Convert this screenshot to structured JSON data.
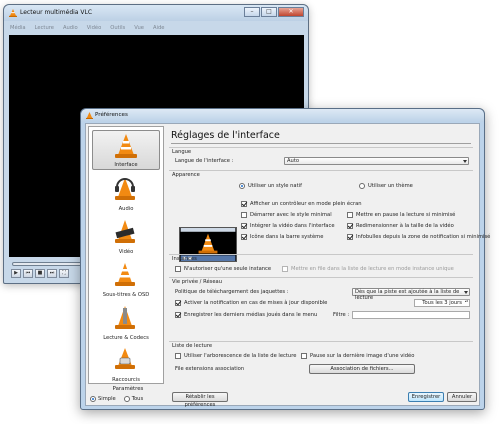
{
  "vlc_window": {
    "title": "Lecteur multimédia VLC",
    "menu": [
      "Média",
      "Lecture",
      "Audio",
      "Vidéo",
      "Outils",
      "Vue",
      "Aide"
    ]
  },
  "preferences": {
    "window_title": "Préférences",
    "sidebar": {
      "items": [
        {
          "label": "Interface",
          "icon": "vlc-cone-icon"
        },
        {
          "label": "Audio",
          "icon": "headphones-cone-icon"
        },
        {
          "label": "Vidéo",
          "icon": "film-cone-icon"
        },
        {
          "label": "Sous-titres & OSD",
          "icon": "subtitles-cone-icon"
        },
        {
          "label": "Lecture & Codecs",
          "icon": "codec-cone-icon"
        },
        {
          "label": "Raccourcis",
          "icon": "hotkeys-cone-icon"
        }
      ],
      "params_label": "Paramètres",
      "simple_label": "Simple",
      "all_label": "Tous"
    },
    "heading": "Réglages de l'interface",
    "langue": {
      "section": "Langue",
      "label": "Langue de l'interface :",
      "value": "Auto"
    },
    "apparence": {
      "section": "Apparence",
      "native_label": "Utiliser un style natif",
      "theme_label": "Utiliser un thème",
      "fullscreen_ctrl": "Afficher un contrôleur en mode plein écran",
      "minimal": "Démarrer avec le style minimal",
      "pause_minimized": "Mettre en pause la lecture si minimisé",
      "embed_video": "Intégrer la vidéo dans l'interface",
      "resize_video": "Redimensionner à la taille de la vidéo",
      "systray": "Icône dans la barre système",
      "popup": "Infobulles depuis la zone de notification si minimisé"
    },
    "instances": {
      "section": "Instances",
      "single": "N'autoriser qu'une seule instance",
      "enqueue": "Mettre en file dans la liste de lecture en mode instance unique"
    },
    "privacy": {
      "section": "Vie privée / Réseau",
      "art_label": "Politique de téléchargement des jaquettes :",
      "art_value": "Dès que la piste est ajoutée à la liste de lecture",
      "updates": "Activer la notification en cas de mises à jour disponible",
      "updates_days": "Tous les 3 jours",
      "recent": "Enregistrer les derniers médias joués dans le menu",
      "filter_label": "Filtre :"
    },
    "playlist": {
      "section": "Liste de lecture",
      "tree": "Utiliser l'arborescence de la liste de lecture",
      "pause_last": "Pause sur la dernière image d'une vidéo",
      "assoc_label": "File extensions association",
      "assoc_button": "Association de fichiers..."
    },
    "buttons": {
      "reset": "Rétablir les préférences",
      "save": "Enregistrer",
      "cancel": "Annuler"
    }
  }
}
